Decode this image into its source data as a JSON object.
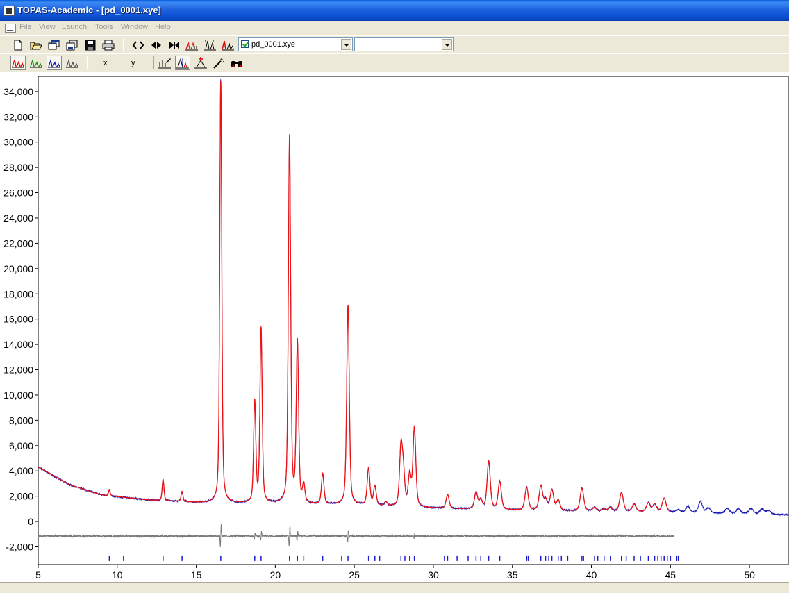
{
  "window": {
    "title": "TOPAS-Academic - [pd_0001.xye]"
  },
  "menu": {
    "items": [
      "File",
      "View",
      "Launch",
      "Tools",
      "Window",
      "Help"
    ]
  },
  "toolbar": {
    "file_combo_value": "pd_0001.xye",
    "file_combo_checked": true,
    "second_combo_value": "",
    "x_label": "x",
    "y_label": "y"
  },
  "colors": {
    "observed": "#1a1ab4",
    "calculated": "#ee1111",
    "difference": "#7a7a7a",
    "tick_marks": "#1a1ad0",
    "title_bar": "#0a4fd0"
  },
  "chart_data": {
    "type": "line",
    "xlim": [
      5,
      52.5
    ],
    "ylim": [
      -3400,
      35200
    ],
    "xticks": [
      "5",
      "10",
      "15",
      "20",
      "25",
      "30",
      "35",
      "40",
      "45",
      "50"
    ],
    "yticks": [
      "-2,000",
      "0",
      "2,000",
      "4,000",
      "6,000",
      "8,000",
      "10,000",
      "12,000",
      "14,000",
      "16,000",
      "18,000",
      "20,000",
      "22,000",
      "24,000",
      "26,000",
      "28,000",
      "30,000",
      "32,000",
      "34,000"
    ],
    "grid": false,
    "background": {
      "note_points": [
        [
          5,
          4300
        ],
        [
          7,
          2900
        ],
        [
          9,
          2100
        ],
        [
          12,
          1700
        ],
        [
          15,
          1500
        ],
        [
          20,
          1400
        ],
        [
          25,
          1300
        ],
        [
          30,
          1050
        ],
        [
          35,
          900
        ],
        [
          40,
          800
        ],
        [
          45,
          720
        ],
        [
          52.5,
          520
        ]
      ]
    },
    "peaks": [
      [
        9.5,
        500
      ],
      [
        12.9,
        1700
      ],
      [
        14.1,
        800
      ],
      [
        16.55,
        33500
      ],
      [
        18.7,
        8000
      ],
      [
        19.1,
        13800
      ],
      [
        20.9,
        28900
      ],
      [
        21.4,
        12600
      ],
      [
        21.8,
        1400
      ],
      [
        23.0,
        2400
      ],
      [
        24.6,
        15800
      ],
      [
        25.9,
        2900
      ],
      [
        26.3,
        1500
      ],
      [
        27.0,
        300
      ],
      [
        27.95,
        4500
      ],
      [
        28.1,
        2500
      ],
      [
        28.5,
        2400
      ],
      [
        28.8,
        6200
      ],
      [
        30.9,
        1100
      ],
      [
        32.7,
        1300
      ],
      [
        33.0,
        700
      ],
      [
        33.5,
        3800
      ],
      [
        34.2,
        2200
      ],
      [
        35.9,
        1800
      ],
      [
        36.8,
        1900
      ],
      [
        37.1,
        800
      ],
      [
        37.5,
        1600
      ],
      [
        37.9,
        800
      ],
      [
        39.4,
        1800
      ],
      [
        40.2,
        300
      ],
      [
        40.8,
        200
      ],
      [
        41.2,
        300
      ],
      [
        41.9,
        1500
      ],
      [
        42.7,
        600
      ],
      [
        43.6,
        700
      ],
      [
        44.0,
        600
      ],
      [
        44.6,
        1100
      ],
      [
        45.5,
        200
      ],
      [
        46.1,
        500
      ],
      [
        46.9,
        900
      ],
      [
        47.4,
        400
      ],
      [
        48.6,
        400
      ],
      [
        49.3,
        400
      ],
      [
        50.1,
        450
      ],
      [
        50.8,
        400
      ],
      [
        51.2,
        300
      ]
    ],
    "difference_level": -1150,
    "calc_end_x": 45.0,
    "difference_end_x": 45.2,
    "reflection_ticks_x": [
      9.5,
      10.4,
      12.9,
      14.1,
      16.55,
      18.7,
      19.1,
      20.9,
      21.4,
      21.8,
      23.0,
      24.2,
      24.6,
      25.9,
      26.3,
      26.6,
      27.95,
      28.2,
      28.5,
      28.8,
      30.7,
      30.9,
      31.5,
      32.2,
      32.7,
      33.0,
      33.5,
      34.2,
      35.9,
      36.0,
      36.8,
      37.1,
      37.3,
      37.5,
      37.9,
      38.1,
      38.5,
      39.4,
      39.5,
      40.2,
      40.4,
      40.8,
      41.2,
      41.9,
      42.2,
      42.7,
      43.1,
      43.6,
      44.0,
      44.2,
      44.4,
      44.6,
      44.8,
      45.0,
      45.4,
      45.5
    ],
    "reflection_tick_level": -2900
  }
}
